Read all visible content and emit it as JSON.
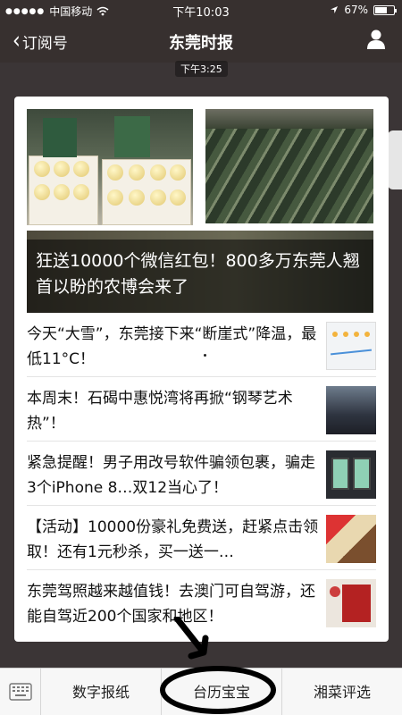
{
  "status_bar": {
    "carrier": "中国移动",
    "time": "下午10:03",
    "battery": "67%",
    "battery_level": 0.67
  },
  "nav": {
    "back_label": "订阅号",
    "title": "东莞时报"
  },
  "message_time": "下午3:25",
  "hero": {
    "headline": "狂送10000个微信红包！800多万东莞人翘首以盼的农博会来了"
  },
  "articles": [
    {
      "title": "今天“大雪”，东莞接下来“断崖式”降温，最低11°C！"
    },
    {
      "title": "本周末！石碣中惠悦湾将再掀“钢琴艺术热”！"
    },
    {
      "title": "紧急提醒！男子用改号软件骗领包裹，骗走3个iPhone 8…双12当心了！"
    },
    {
      "title": "【活动】10000份豪礼免费送，赶紧点击领取！还有1元秒杀，买一送一…"
    },
    {
      "title": "东莞驾照越来越值钱！去澳门可自驾游，还能自驾近200个国家和地区！"
    }
  ],
  "bottom_menu": {
    "items": [
      "数字报纸",
      "台历宝宝",
      "湘菜评选"
    ]
  },
  "colors": {
    "nav_bg": "#37302f",
    "card_bg": "#ffffff",
    "menu_bg": "#f7f7f7"
  }
}
